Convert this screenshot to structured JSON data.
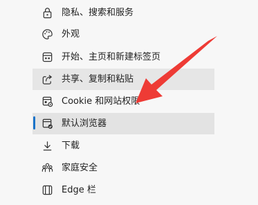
{
  "menu": {
    "items": [
      {
        "label": "隐私、搜索和服务",
        "icon": "lock-icon"
      },
      {
        "label": "外观",
        "icon": "palette-icon"
      },
      {
        "label": "开始、主页和新建标签页",
        "icon": "home-tab-icon"
      },
      {
        "label": "共享、复制和粘贴",
        "icon": "share-icon"
      },
      {
        "label": "Cookie 和网站权限",
        "icon": "site-permissions-icon"
      },
      {
        "label": "默认浏览器",
        "icon": "default-browser-icon"
      },
      {
        "label": "下载",
        "icon": "download-icon"
      },
      {
        "label": "家庭安全",
        "icon": "family-icon"
      },
      {
        "label": "Edge 栏",
        "icon": "edge-bar-icon"
      }
    ],
    "selected_index": 5
  },
  "colors": {
    "accent": "#1a73c9",
    "annotation_arrow": "#ee3b35"
  }
}
